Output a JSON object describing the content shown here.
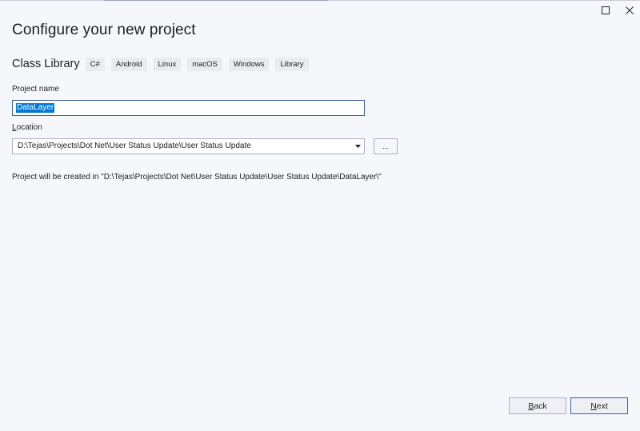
{
  "window": {
    "maximize_icon": "maximize-icon",
    "close_icon": "close-icon"
  },
  "page": {
    "title": "Configure your new project"
  },
  "template": {
    "name": "Class Library",
    "tags": [
      "C#",
      "Android",
      "Linux",
      "macOS",
      "Windows",
      "Library"
    ]
  },
  "project_name": {
    "label": "Project name",
    "value": "DataLayer"
  },
  "location": {
    "label_accel": "L",
    "label_rest": "ocation",
    "value": "D:\\Tejas\\Projects\\Dot Net\\User Status Update\\User Status Update",
    "browse_label": "..."
  },
  "info": {
    "path_text": "Project will be created in \"D:\\Tejas\\Projects\\Dot Net\\User Status Update\\User Status Update\\DataLayer\\\""
  },
  "buttons": {
    "back_accel": "B",
    "back_rest": "ack",
    "next_accel": "N",
    "next_rest": "ext"
  },
  "colors": {
    "background": "#f6f7fb",
    "focus_border": "#3b5fa8",
    "selection": "#0078d7"
  }
}
